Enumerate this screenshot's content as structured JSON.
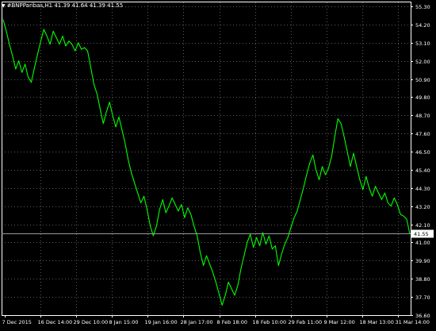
{
  "header": {
    "symbol_label": "#BNPParibas,H1",
    "ohlc": "41.39 41.64 41.39 41.55",
    "menu_glyph": "▼"
  },
  "colors": {
    "background": "#000000",
    "line": "#00ff00",
    "grid": "#5a5a5a",
    "axis": "#ffffff",
    "price_tag_bg": "#ffffff",
    "price_tag_text": "#000000"
  },
  "chart_data": {
    "type": "line",
    "title": "",
    "xlabel": "",
    "ylabel": "",
    "ylim": [
      36.6,
      55.3
    ],
    "y_ticks": [
      "55.30",
      "54.20",
      "53.10",
      "52.00",
      "50.90",
      "49.80",
      "48.70",
      "47.60",
      "46.50",
      "45.40",
      "44.30",
      "43.20",
      "42.10",
      "41.00",
      "39.90",
      "38.80",
      "37.70",
      "36.60"
    ],
    "x_ticks": [
      "7 Dec 2015",
      "16 Dec 14:00",
      "29 Dec 10:00",
      "8 Jan 15:00",
      "19 Jan 16:00",
      "28 Jan 17:00",
      "8 Feb 18:00",
      "18 Feb 10:00",
      "29 Feb 11:00",
      "9 Mar 12:00",
      "18 Mar 13:00",
      "31 Mar 14:00"
    ],
    "current_price": "41.55",
    "grid": true,
    "grid_style": "dotted",
    "series": [
      {
        "x": [
          0,
          1,
          2,
          3,
          4,
          5,
          6,
          7,
          8,
          9,
          10,
          11,
          12,
          13,
          14,
          15,
          16,
          17,
          18,
          19,
          20,
          21,
          22,
          23,
          24,
          25,
          26,
          27,
          28,
          29,
          30,
          31,
          32,
          33,
          34,
          35,
          36,
          37,
          38,
          39,
          40,
          41,
          42,
          43,
          44,
          45,
          46,
          47,
          48,
          49,
          50,
          51,
          52,
          53,
          54,
          55,
          56,
          57,
          58,
          59,
          60,
          61,
          62,
          63,
          64,
          65,
          66,
          67,
          68,
          69,
          70,
          71,
          72,
          73,
          74,
          75,
          76,
          77,
          78,
          79,
          80,
          81,
          82,
          83,
          84,
          85,
          86,
          87,
          88,
          89,
          90,
          91,
          92,
          93,
          94,
          95,
          96,
          97,
          98,
          99,
          100,
          101,
          102,
          103,
          104,
          105,
          106,
          107,
          108,
          109,
          110,
          111,
          112,
          113,
          114,
          115,
          116,
          117,
          118,
          119,
          120,
          121,
          122,
          123,
          124,
          125,
          126,
          127,
          128,
          129,
          130
        ],
        "values": [
          54.5,
          53.8,
          53.0,
          52.3,
          51.5,
          52.0,
          51.3,
          51.8,
          51.0,
          50.7,
          51.6,
          52.4,
          53.2,
          53.9,
          53.5,
          53.0,
          53.8,
          53.4,
          53.0,
          53.5,
          52.9,
          53.2,
          53.0,
          52.6,
          53.1,
          52.7,
          52.8,
          52.6,
          51.6,
          50.6,
          50.0,
          49.1,
          48.2,
          48.9,
          49.5,
          48.7,
          48.0,
          48.6,
          47.8,
          47.0,
          46.0,
          45.2,
          44.6,
          44.0,
          43.4,
          43.8,
          43.0,
          42.0,
          41.4,
          42.0,
          43.0,
          43.6,
          42.8,
          43.2,
          43.7,
          43.3,
          42.9,
          43.3,
          42.5,
          43.1,
          42.7,
          42.0,
          41.4,
          40.4,
          39.6,
          40.2,
          39.7,
          39.2,
          38.6,
          37.9,
          37.2,
          37.8,
          38.6,
          38.2,
          37.8,
          38.4,
          39.4,
          40.2,
          41.0,
          41.5,
          40.7,
          41.3,
          40.8,
          41.6,
          40.9,
          41.4,
          40.6,
          40.8,
          39.6,
          40.3,
          40.9,
          41.3,
          41.9,
          42.5,
          42.9,
          43.6,
          44.3,
          45.1,
          45.8,
          46.3,
          45.4,
          44.8,
          45.6,
          45.1,
          45.5,
          46.2,
          47.4,
          48.5,
          48.2,
          47.4,
          46.5,
          45.6,
          46.4,
          45.6,
          44.8,
          44.2,
          45.0,
          44.3,
          43.8,
          44.4,
          44.0,
          43.6,
          44.0,
          43.4,
          43.2,
          43.7,
          43.3,
          42.7,
          42.6,
          42.4,
          41.5
        ]
      }
    ]
  }
}
